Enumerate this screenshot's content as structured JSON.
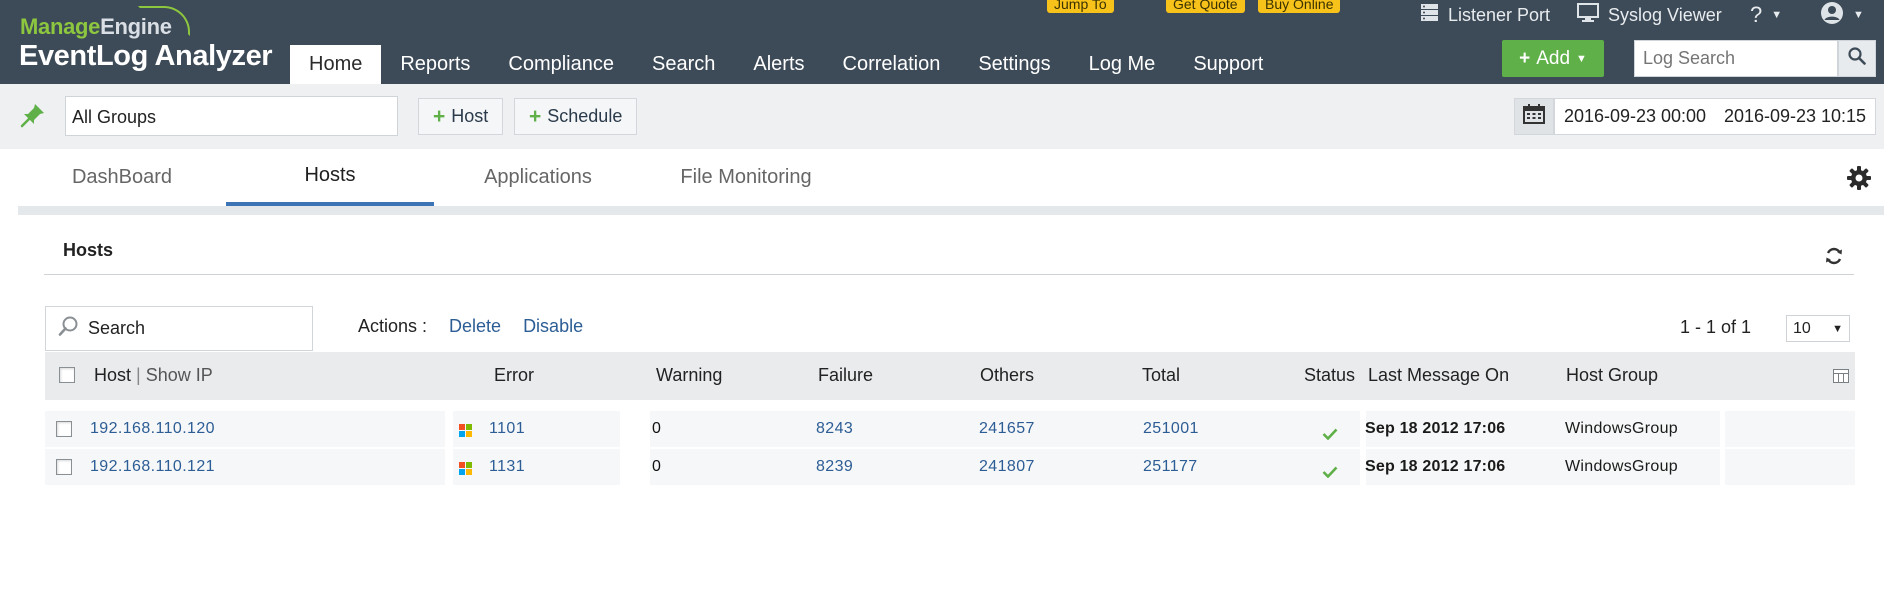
{
  "brand": {
    "company_part1": "Manage",
    "company_part2": "Engine",
    "product": "EventLog Analyzer"
  },
  "header": {
    "jump_to": "Jump To",
    "get_quote": "Get Quote",
    "buy_online": "Buy Online",
    "listener_port": "Listener Port",
    "syslog_viewer": "Syslog Viewer",
    "help": "?",
    "add_label": "Add",
    "log_search_placeholder": "Log Search"
  },
  "nav": {
    "items": [
      {
        "label": "Home",
        "active": true
      },
      {
        "label": "Reports"
      },
      {
        "label": "Compliance"
      },
      {
        "label": "Search"
      },
      {
        "label": "Alerts"
      },
      {
        "label": "Correlation"
      },
      {
        "label": "Settings"
      },
      {
        "label": "Log Me"
      },
      {
        "label": "Support"
      }
    ]
  },
  "filter": {
    "group": "All Groups",
    "host_btn": "Host",
    "schedule_btn": "Schedule",
    "date_from": "2016-09-23 00:00",
    "date_to": "2016-09-23 10:15"
  },
  "tabs": [
    {
      "label": "DashBoard"
    },
    {
      "label": "Hosts",
      "active": true
    },
    {
      "label": "Applications"
    },
    {
      "label": "File Monitoring"
    }
  ],
  "panel": {
    "title": "Hosts",
    "search_placeholder": "Search",
    "actions_label": "Actions :",
    "delete": "Delete",
    "disable": "Disable",
    "pager": "1 - 1 of 1",
    "page_size": "10"
  },
  "table": {
    "columns": {
      "host": "Host",
      "sep": "|",
      "show_ip": "Show IP",
      "error": "Error",
      "warning": "Warning",
      "failure": "Failure",
      "others": "Others",
      "total": "Total",
      "status": "Status",
      "last_message": "Last Message On",
      "host_group": "Host Group"
    },
    "rows": [
      {
        "host": "192.168.110.120",
        "os_icon": "windows-icon",
        "error": "1101",
        "warning": "0",
        "failure": "8243",
        "others": "241657",
        "total": "251001",
        "status": "ok",
        "last_message": "Sep 18 2012 17:06",
        "host_group": "WindowsGroup"
      },
      {
        "host": "192.168.110.121",
        "os_icon": "windows-icon",
        "error": "1131",
        "warning": "0",
        "failure": "8239",
        "others": "241807",
        "total": "251177",
        "status": "ok",
        "last_message": "Sep 18 2012 17:06",
        "host_group": "WindowsGroup"
      }
    ]
  },
  "colors": {
    "header_bg": "#3d4a57",
    "brand_green": "#8dc63f",
    "add_green": "#5fb048",
    "link_blue": "#2c5d95",
    "tab_accent": "#3d74b5",
    "pill_yellow": "#f7c21a"
  }
}
